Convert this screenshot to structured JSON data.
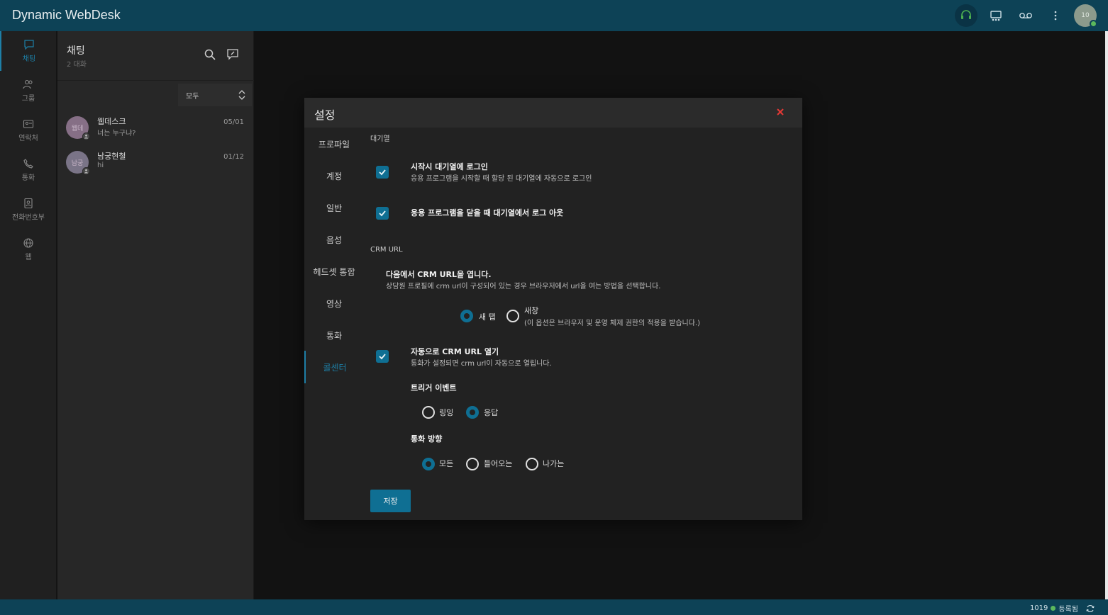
{
  "app": {
    "title": "Dynamic WebDesk"
  },
  "topbar": {
    "avatar_text": "10",
    "status_color": "#5cb85c"
  },
  "nav": [
    {
      "label": "채팅",
      "icon": "chat-icon",
      "active": true
    },
    {
      "label": "그룹",
      "icon": "group-icon"
    },
    {
      "label": "연락처",
      "icon": "contacts-icon"
    },
    {
      "label": "통화",
      "icon": "phone-icon"
    },
    {
      "label": "전화번호부",
      "icon": "phonebook-icon"
    },
    {
      "label": "웹",
      "icon": "globe-icon"
    }
  ],
  "chat": {
    "title": "채팅",
    "subtitle": "2 대화",
    "filter": "모두",
    "conversations": [
      {
        "avatar": "웹데",
        "name": "웹데스크",
        "message": "너는 누구냐?",
        "date": "05/01"
      },
      {
        "avatar": "남궁",
        "name": "남궁현철",
        "message": "hi",
        "date": "01/12"
      }
    ]
  },
  "modal": {
    "title": "설정",
    "tabs": [
      "프로파일",
      "계정",
      "일반",
      "음성",
      "헤드셋 통합",
      "영상",
      "통화",
      "콜센터"
    ],
    "active_tab": "콜센터",
    "queue_section": "대기열",
    "login_on_start_title": "시작시 대기열에 로그인",
    "login_on_start_desc": "응용 프로그램을 시작할 때 할당 된 대기열에 자동으로 로그인",
    "logout_on_close_title": "응용 프로그램을 닫을 때 대기열에서 로그 아웃",
    "crm_section": "CRM URL",
    "crm_open_title": "다음에서 CRM URL을 엽니다.",
    "crm_open_desc": "상담원 프로필에 crm url이 구성되어 있는 경우 브라우저에서 url을 여는 방법을 선택합니다.",
    "crm_open_options": {
      "new_tab": "새 탭",
      "new_window": "새창",
      "new_window_note": "(이 옵션은 브라우저 및 운영 체제 권한의 적용을 받습니다.)"
    },
    "auto_open_title": "자동으로 CRM URL 열기",
    "auto_open_desc": "통화가 설정되면 crm url이 자동으로 열립니다.",
    "trigger_title": "트리거 이벤트",
    "trigger_options": [
      "링잉",
      "응답"
    ],
    "direction_title": "통화 방향",
    "direction_options": [
      "모든",
      "들어오는",
      "나가는"
    ],
    "save": "저장"
  },
  "status": {
    "extension": "1019",
    "state": "등록됨"
  },
  "colors": {
    "accent": "#0f6f93",
    "topbar": "#0d4256",
    "close": "#e53935"
  }
}
